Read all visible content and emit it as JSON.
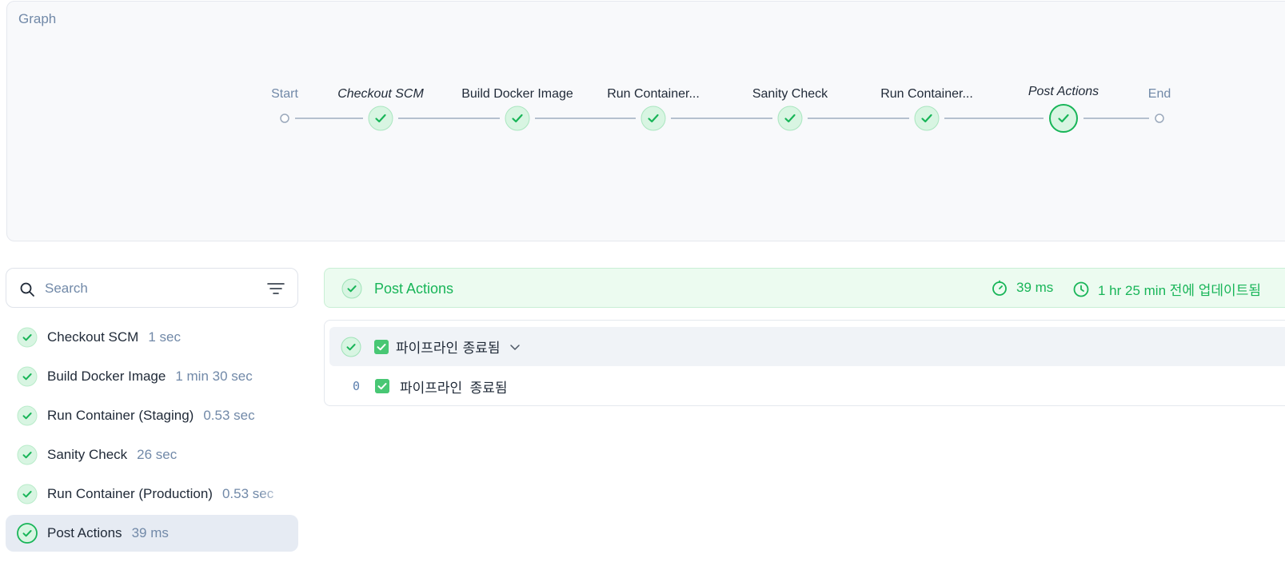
{
  "colors": {
    "success": "#18b558",
    "success_bg": "#d8f5e2",
    "connector": "#b5c0ce",
    "muted_text": "#7189a8",
    "selected_bg": "#e6ebf3"
  },
  "graph": {
    "title": "Graph",
    "nodes": [
      {
        "label": "Start",
        "kind": "terminal",
        "style": "muted"
      },
      {
        "label": "Checkout SCM",
        "kind": "stage",
        "style": "italic",
        "status": "success"
      },
      {
        "label": "Build Docker Image",
        "kind": "stage",
        "style": "normal",
        "status": "success"
      },
      {
        "label": "Run Container...",
        "kind": "stage",
        "style": "normal",
        "status": "success"
      },
      {
        "label": "Sanity Check",
        "kind": "stage",
        "style": "normal",
        "status": "success"
      },
      {
        "label": "Run Container...",
        "kind": "stage",
        "style": "normal",
        "status": "success"
      },
      {
        "label": "Post Actions",
        "kind": "stage",
        "style": "italic",
        "status": "success",
        "selected": true
      },
      {
        "label": "End",
        "kind": "terminal",
        "style": "muted"
      }
    ]
  },
  "search": {
    "placeholder": "Search",
    "value": ""
  },
  "stages": [
    {
      "name": "Checkout SCM",
      "duration": "1 sec",
      "status": "success",
      "selected": false
    },
    {
      "name": "Build Docker Image",
      "duration": "1 min 30 sec",
      "status": "success",
      "selected": false
    },
    {
      "name": "Run Container (Staging)",
      "duration": "0.53 sec",
      "status": "success",
      "selected": false
    },
    {
      "name": "Sanity Check",
      "duration": "26 sec",
      "status": "success",
      "selected": false
    },
    {
      "name": "Run Container (Production)",
      "duration": "0.53 sec",
      "status": "success",
      "selected": false
    },
    {
      "name": "Post Actions",
      "duration": "39 ms",
      "status": "success",
      "selected": true
    }
  ],
  "detail": {
    "title": "Post Actions",
    "duration": "39 ms",
    "updated": "1 hr 25 min 전에 업데이트됨",
    "step": {
      "label": "파이프라인 종료됨",
      "log": [
        {
          "line": "0",
          "text": "파이프라인 종료됨"
        }
      ]
    }
  },
  "icons": {
    "status": "check-circle-icon",
    "search": "search-icon",
    "filter": "filter-icon",
    "timer": "timer-icon",
    "clock": "clock-icon",
    "checkbox": "checkbox-icon",
    "chevron": "chevron-down-icon"
  }
}
